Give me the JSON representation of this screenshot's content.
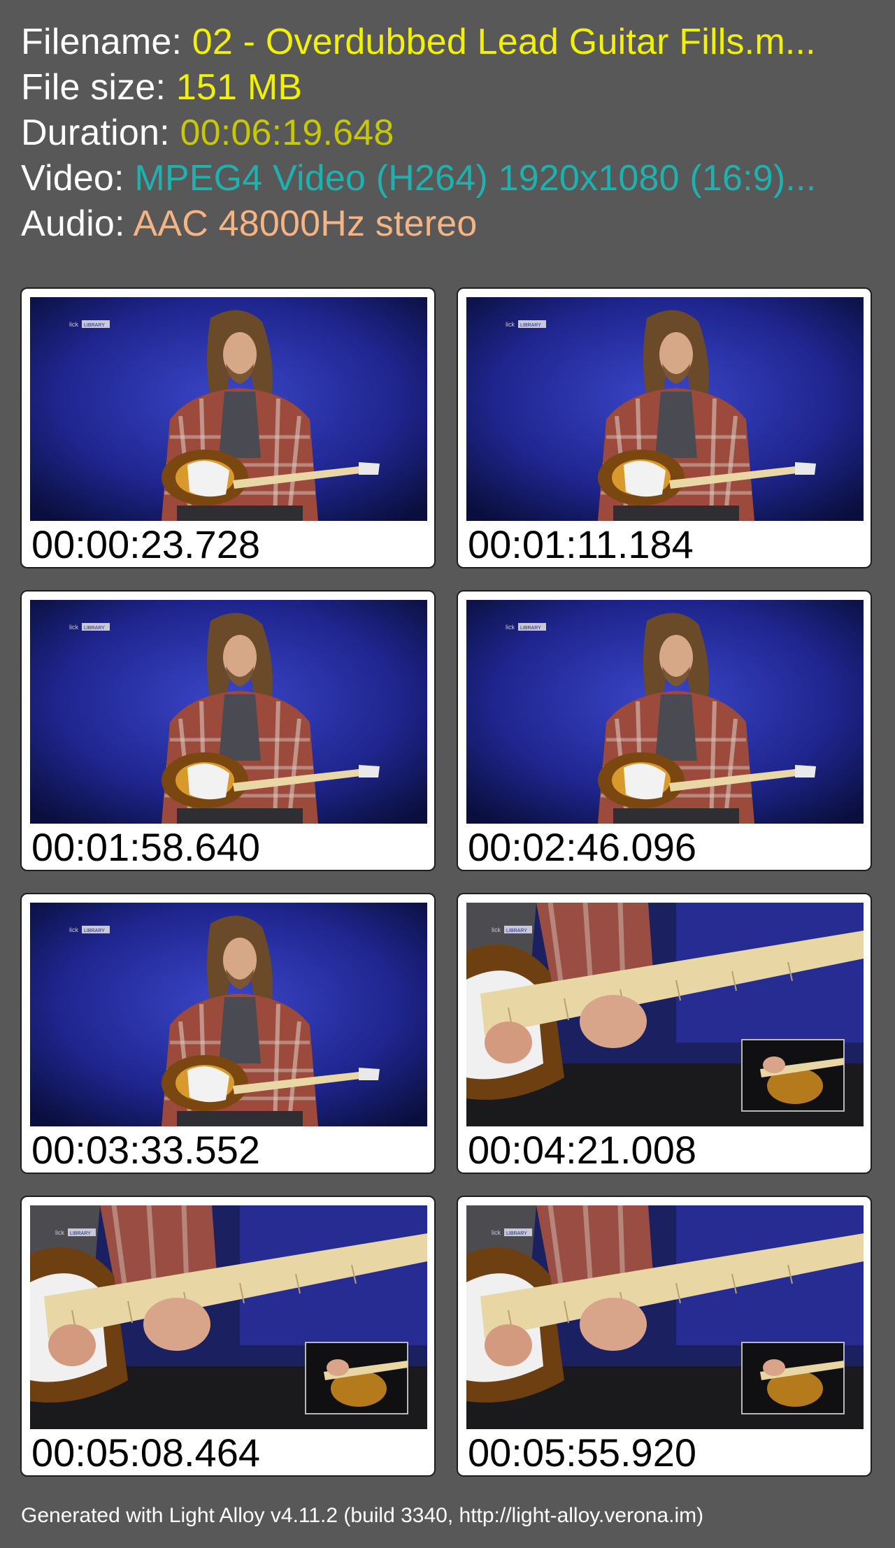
{
  "info": {
    "filename": {
      "label": "Filename:",
      "value": "02 - Overdubbed Lead Guitar Fills.m...",
      "color": "#f2f200"
    },
    "filesize": {
      "label": "File size:",
      "value": "151 MB",
      "color": "#f2f200"
    },
    "duration": {
      "label": "Duration:",
      "value": "00:06:19.648",
      "color": "#c8c800"
    },
    "video": {
      "label": "Video:",
      "value": "MPEG4 Video (H264) 1920x1080 (16:9)...",
      "color": "#1fb0b0"
    },
    "audio": {
      "label": "Audio:",
      "value": "AAC 48000Hz stereo",
      "color": "#f5b482"
    }
  },
  "thumbnails": [
    {
      "timestamp": "00:00:23.728",
      "scene": "wide-shot-presenter"
    },
    {
      "timestamp": "00:01:11.184",
      "scene": "wide-shot-presenter"
    },
    {
      "timestamp": "00:01:58.640",
      "scene": "wide-shot-presenter"
    },
    {
      "timestamp": "00:02:46.096",
      "scene": "wide-shot-presenter"
    },
    {
      "timestamp": "00:03:33.552",
      "scene": "wide-shot-presenter"
    },
    {
      "timestamp": "00:04:21.008",
      "scene": "closeup-fretboard-with-inset"
    },
    {
      "timestamp": "00:05:08.464",
      "scene": "closeup-fretboard-with-inset"
    },
    {
      "timestamp": "00:05:55.920",
      "scene": "closeup-fretboard-with-inset"
    }
  ],
  "watermark": "lick LIBRARY",
  "footer": "Generated with Light Alloy v4.11.2 (build 3340, http://light-alloy.verona.im)"
}
